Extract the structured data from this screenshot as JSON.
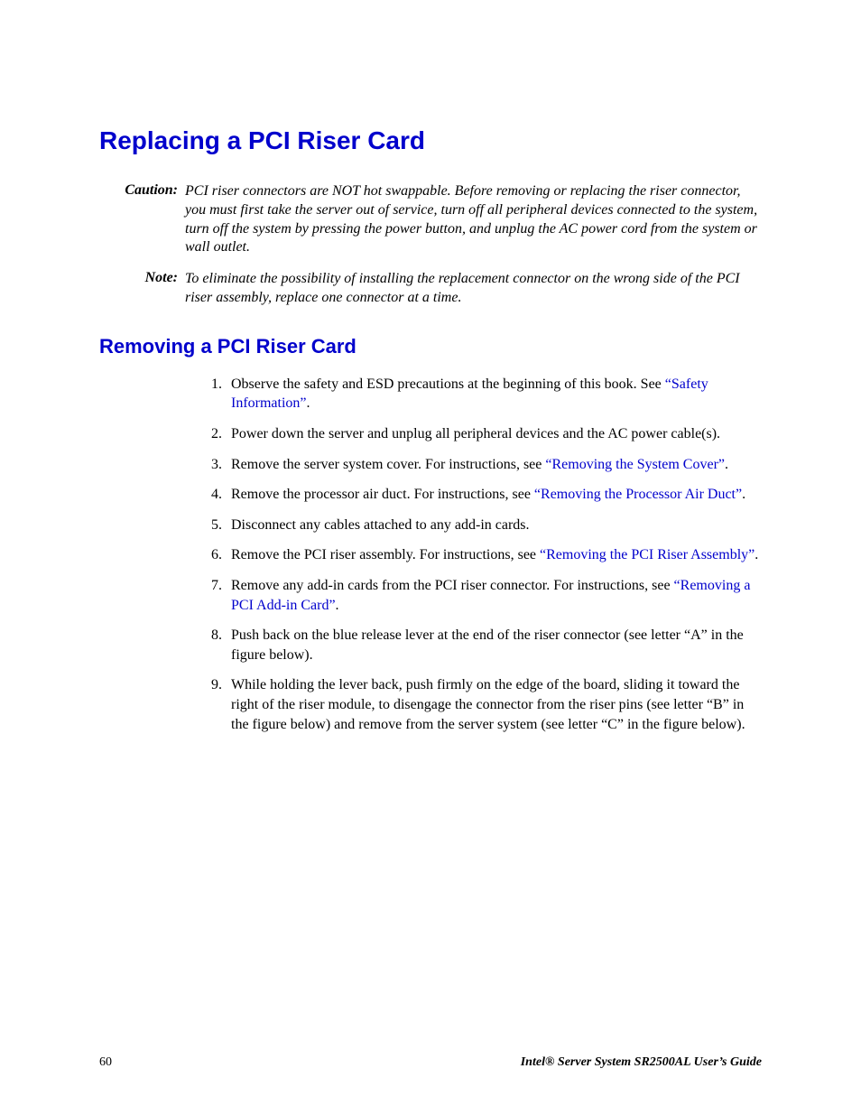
{
  "heading_main": "Replacing a PCI Riser Card",
  "caution": {
    "label": "Caution:",
    "body": "PCI riser connectors are NOT hot swappable. Before removing or replacing the riser connector, you must first take the server out of service, turn off all peripheral devices connected to the system, turn off the system by pressing the power button, and unplug the AC power cord from the system or wall outlet."
  },
  "note": {
    "label": "Note:",
    "body": "To eliminate the possibility of installing the replacement connector on the wrong side of the PCI riser assembly, replace one connector at a time."
  },
  "heading_sub": "Removing a PCI Riser Card",
  "steps": {
    "s1a": "Observe the safety and ESD precautions at the beginning of this book. See ",
    "s1link": "“Safety Information”",
    "s1b": ".",
    "s2": "Power down the server and unplug all peripheral devices and the AC power cable(s).",
    "s3a": "Remove the server system cover. For instructions, see ",
    "s3link": "“Removing the System Cover”",
    "s3b": ".",
    "s4a": "Remove the processor air duct. For instructions, see ",
    "s4link": "“Removing the Processor Air Duct”",
    "s4b": ".",
    "s5": "Disconnect any cables attached to any add-in cards.",
    "s6a": "Remove the PCI riser assembly. For instructions, see ",
    "s6link": "“Removing the PCI Riser Assembly”",
    "s6b": ".",
    "s7a": "Remove any add-in cards from the PCI riser connector. For instructions, see ",
    "s7link": "“Removing a PCI Add-in Card”",
    "s7b": ".",
    "s8": "Push back on the blue release lever at the end of the riser connector (see letter “A” in the figure below).",
    "s9": "While holding the lever back, push firmly on the edge of the board, sliding it toward the right of the riser module, to disengage the connector from the riser pins (see letter “B” in the figure below) and remove from the server system (see letter “C” in the figure below)."
  },
  "footer": {
    "page": "60",
    "title": "Intel® Server System SR2500AL User’s Guide"
  }
}
